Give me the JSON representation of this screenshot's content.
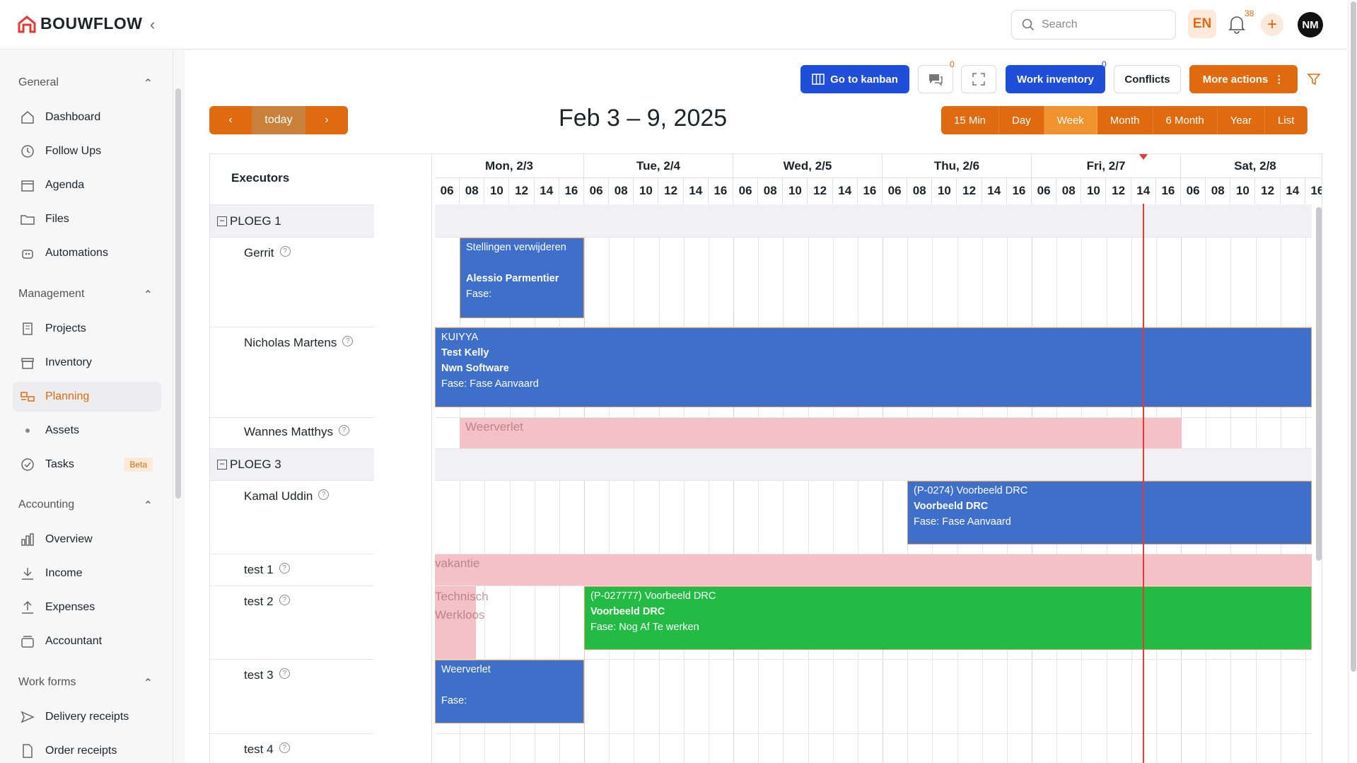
{
  "header": {
    "brand": "BOUWFLOW",
    "search_placeholder": "Search",
    "language": "EN",
    "notification_count": "38",
    "avatar_initials": "NM"
  },
  "sidebar": {
    "sections": [
      {
        "title": "General",
        "items": [
          "Dashboard",
          "Follow Ups",
          "Agenda",
          "Files",
          "Automations"
        ]
      },
      {
        "title": "Management",
        "items": [
          "Projects",
          "Inventory",
          "Planning",
          "Assets",
          "Tasks"
        ]
      },
      {
        "title": "Accounting",
        "items": [
          "Overview",
          "Income",
          "Expenses",
          "Accountant"
        ]
      },
      {
        "title": "Work forms",
        "items": [
          "Delivery receipts",
          "Order receipts"
        ]
      }
    ],
    "active_item": "Planning",
    "tasks_badge": "Beta"
  },
  "toolbar": {
    "kanban_label": "Go to kanban",
    "comments_badge": "0",
    "work_inventory_label": "Work inventory",
    "work_inventory_badge": "0",
    "conflicts_label": "Conflicts",
    "more_actions_label": "More actions"
  },
  "calendar": {
    "today_label": "today",
    "title": "Feb 3 – 9, 2025",
    "views": [
      "15 Min",
      "Day",
      "Week",
      "Month",
      "6 Month",
      "Year",
      "List"
    ],
    "selected_view": "Week",
    "resource_header": "Executors",
    "days": [
      "Mon, 2/3",
      "Tue, 2/4",
      "Wed, 2/5",
      "Thu, 2/6",
      "Fri, 2/7",
      "Sat, 2/8"
    ],
    "hours": [
      "06",
      "08",
      "10",
      "12",
      "14",
      "16"
    ],
    "resources": [
      {
        "type": "group",
        "label": "PLOEG 1"
      },
      {
        "type": "person",
        "label": "Gerrit"
      },
      {
        "type": "person",
        "label": "Nicholas Martens"
      },
      {
        "type": "person",
        "label": "Wannes Matthys"
      },
      {
        "type": "group",
        "label": "PLOEG 3"
      },
      {
        "type": "person",
        "label": "Kamal Uddin"
      },
      {
        "type": "person",
        "label": "test 1"
      },
      {
        "type": "person",
        "label": "test 2"
      },
      {
        "type": "person",
        "label": "test 3"
      },
      {
        "type": "person",
        "label": "test 4"
      }
    ],
    "events": [
      {
        "title": "Stellingen verwijderen",
        "sub": "Alessio Parmentier",
        "fase": "Fase:"
      },
      {
        "title": "KUIYYA",
        "sub1": "Test Kelly",
        "sub2": "Nwn Software",
        "fase": "Fase: Fase Aanvaard"
      },
      {
        "title": "Weerverlet"
      },
      {
        "title": "(P-0274) Voorbeeld DRC",
        "sub": "Voorbeeld DRC",
        "fase": "Fase: Fase Aanvaard"
      },
      {
        "title": "vakantie"
      },
      {
        "title": "Technisch Werkloos"
      },
      {
        "title": "(P-027777) Voorbeeld DRC",
        "sub": "Voorbeeld DRC",
        "fase": "Fase: Nog Af Te werken"
      },
      {
        "title": "Weerverlet",
        "fase": "Fase:"
      }
    ]
  },
  "colors": {
    "accent": "#e06a10",
    "primary": "#1f4fd8",
    "event_blue": "#3d6fcb",
    "event_green": "#22bb44",
    "absence_pink": "#f4c2c6",
    "now_line": "#e53935"
  }
}
